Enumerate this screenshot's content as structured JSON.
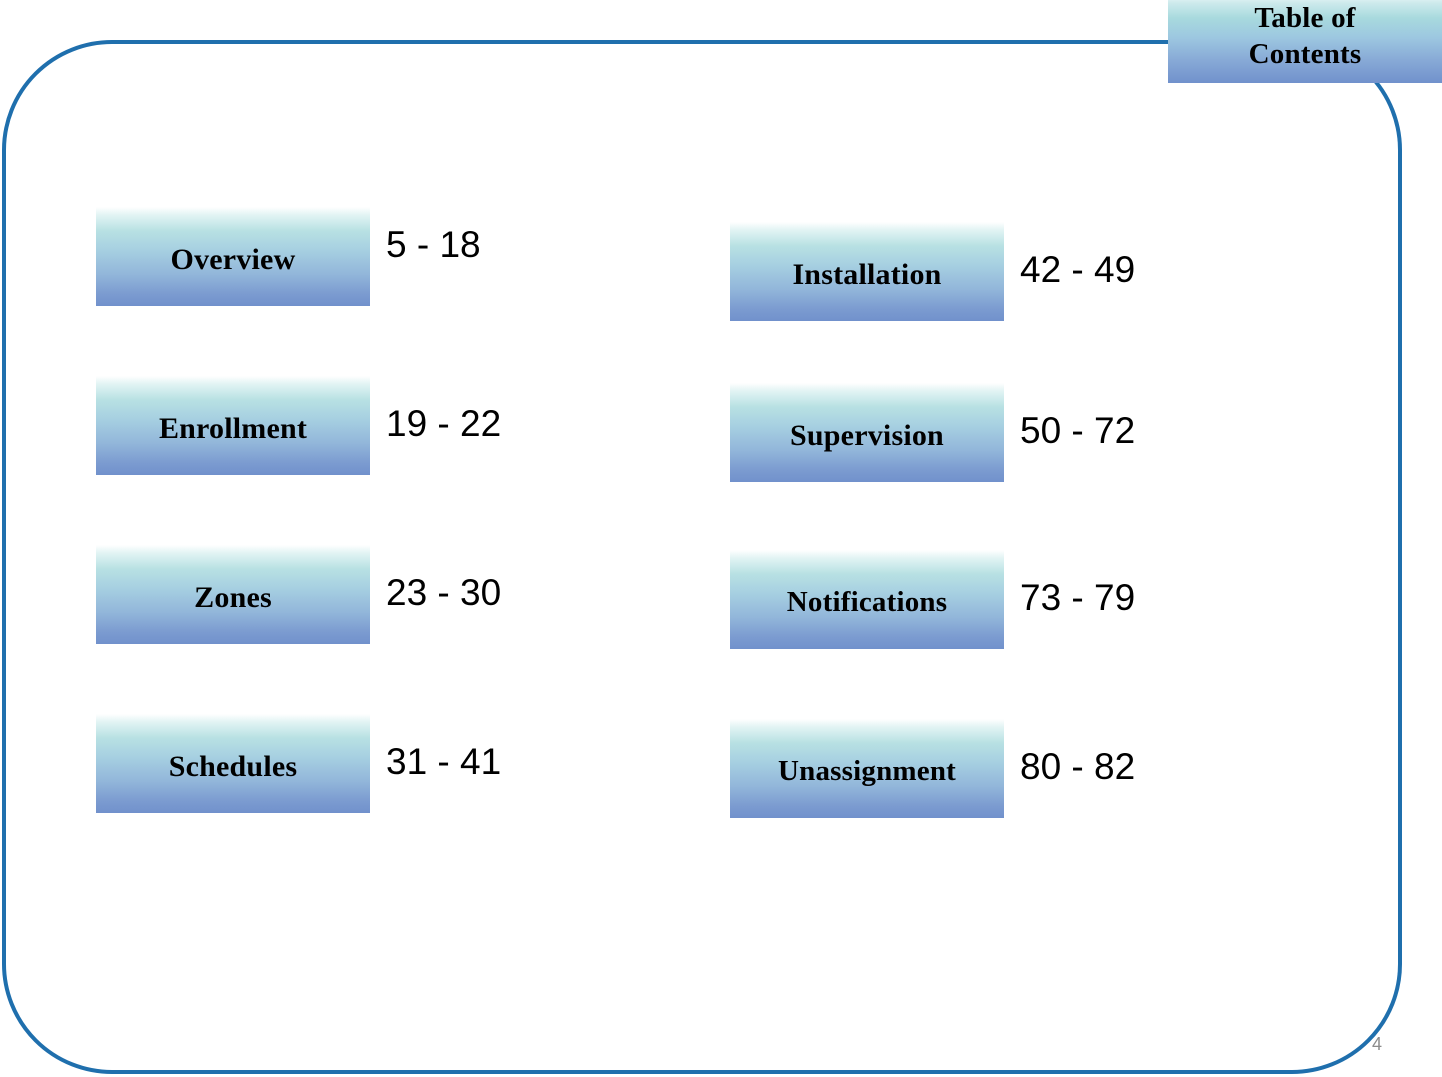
{
  "slide": {
    "title": "Table of\nContents",
    "page_number": "4",
    "colors": {
      "frame_border": "#1f6fad",
      "chip_gradient_top": "#ffffff",
      "chip_gradient_mid": "#a6cfe1",
      "chip_gradient_bottom": "#7191cc",
      "page_number_text": "#8c8c8c",
      "label_text": "#000000"
    }
  },
  "toc": {
    "left_column": [
      {
        "label": "Overview",
        "pages": "5 - 18"
      },
      {
        "label": "Enrollment",
        "pages": "19 - 22"
      },
      {
        "label": "Zones",
        "pages": "23 - 30"
      },
      {
        "label": "Schedules",
        "pages": "31 - 41"
      }
    ],
    "right_column": [
      {
        "label": "Installation",
        "pages": "42 - 49"
      },
      {
        "label": "Supervision",
        "pages": "50 - 72"
      },
      {
        "label": "Notifications",
        "pages": "73 - 79"
      },
      {
        "label": "Unassignment",
        "pages": "80 - 82"
      }
    ]
  }
}
